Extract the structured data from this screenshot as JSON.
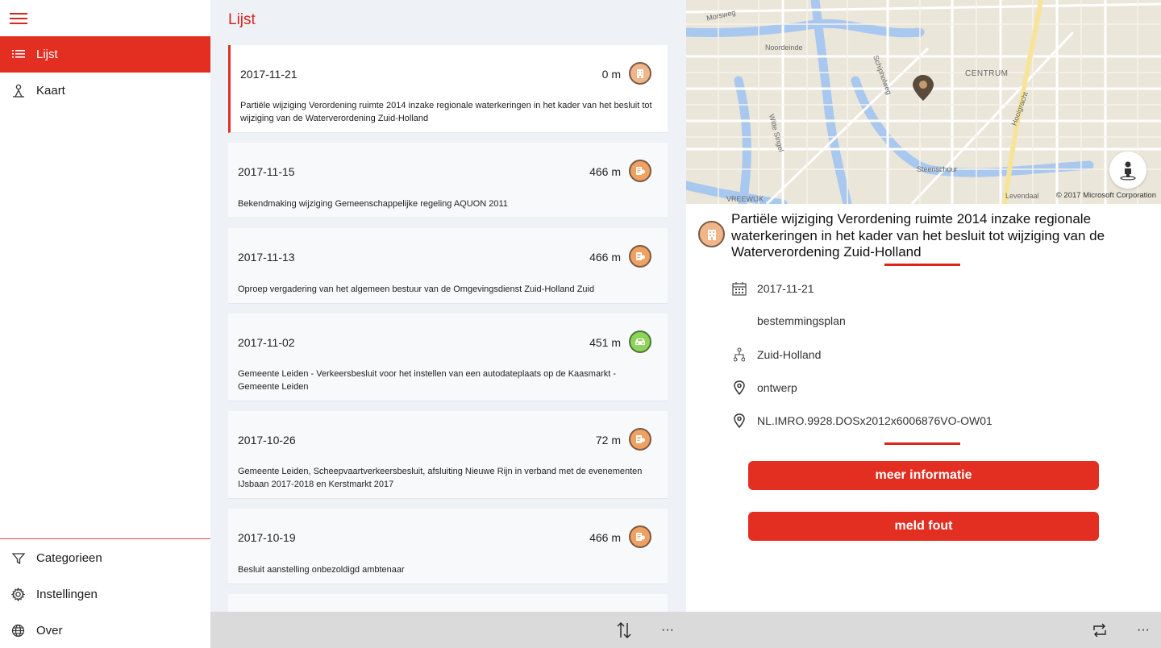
{
  "sidebar": {
    "items": [
      {
        "label": "Lijst",
        "icon": "list-icon"
      },
      {
        "label": "Kaart",
        "icon": "map-person-icon"
      }
    ],
    "footer_items": [
      {
        "label": "Categorieen",
        "icon": "filter-icon"
      },
      {
        "label": "Instellingen",
        "icon": "gear-icon"
      },
      {
        "label": "Over",
        "icon": "globe-icon"
      }
    ]
  },
  "list": {
    "title": "Lijst",
    "cards": [
      {
        "date": "2017-11-21",
        "distance": "0 m",
        "category": "building-icon",
        "color": "#f0b68a",
        "text": "Partiële wijziging Verordening ruimte 2014 inzake regionale waterkeringen in het kader van het besluit tot wijziging van de Waterverordening Zuid-Holland"
      },
      {
        "date": "2017-11-15",
        "distance": "466 m",
        "category": "document-icon",
        "color": "#f0a060",
        "text": "Bekendmaking wijziging Gemeenschappelijke regeling AQUON 2011"
      },
      {
        "date": "2017-11-13",
        "distance": "466 m",
        "category": "document-icon",
        "color": "#f0a060",
        "text": "Oproep vergadering van het algemeen bestuur van de Omgevingsdienst Zuid-Holland Zuid"
      },
      {
        "date": "2017-11-02",
        "distance": "451 m",
        "category": "car-icon",
        "color": "#8fd35a",
        "text": "Gemeente Leiden - Verkeersbesluit voor het instellen van een autodateplaats op de Kaasmarkt - Gemeente Leiden"
      },
      {
        "date": "2017-10-26",
        "distance": "72 m",
        "category": "document-icon",
        "color": "#f0a060",
        "text": "Gemeente Leiden, Scheepvaartverkeersbesluit, afsluiting Nieuwe Rijn in verband met de evenementen IJsbaan 2017-2018 en Kerstmarkt 2017"
      },
      {
        "date": "2017-10-19",
        "distance": "466 m",
        "category": "document-icon",
        "color": "#f0a060",
        "text": "Besluit aanstelling onbezoldigd ambtenaar"
      }
    ]
  },
  "map": {
    "credit": "© 2017 Microsoft Corporation",
    "labels": {
      "centrum": "CENTRUM",
      "noordeinde": "Noordeinde",
      "morsweg": "Morsweg",
      "steenschuur": "Steenschuur",
      "levendaal": "Levendaal",
      "vreewijk": "VREEWIJK",
      "witte_singel": "Witte Singel",
      "hooigracht": "Hooigracht",
      "schipholweg": "Schipholweg"
    }
  },
  "detail": {
    "title": "Partiële wijziging Verordening ruimte 2014 inzake regionale waterkeringen in het kader van het besluit tot wijziging van de Waterverordening Zuid-Holland",
    "date": "2017-11-21",
    "type": "bestemmingsplan",
    "region": "Zuid-Holland",
    "status": "ontwerp",
    "id": "NL.IMRO.9928.DOSx2012x6006876VO-OW01",
    "button_more": "meer informatie",
    "button_report": "meld fout"
  },
  "bottombar": {
    "more_label": "···"
  },
  "colors": {
    "accent": "#e32e22",
    "list_bg": "#eef1f6"
  }
}
